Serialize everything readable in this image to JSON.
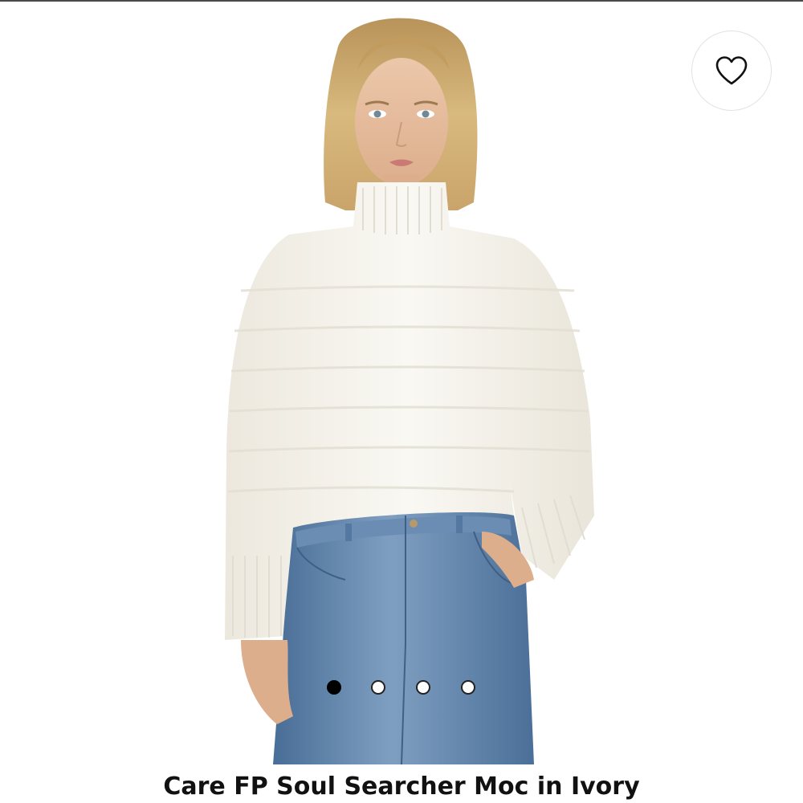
{
  "product": {
    "title": "Care FP Soul Searcher Moc in Ivory",
    "image": {
      "description_icon": "product-photo",
      "colors": {
        "background": "#ffffff",
        "sweater": "#f6f3ec",
        "denim": "#5a7fa6",
        "hair": "#c9a66b",
        "skin": "#e8c1a4"
      }
    }
  },
  "favorite": {
    "icon": "heart-outline-icon"
  },
  "carousel": {
    "total": 4,
    "active_index": 0
  },
  "colors": {
    "text": "#111111",
    "dot_active": "#000000",
    "dot_border": "#222222"
  }
}
